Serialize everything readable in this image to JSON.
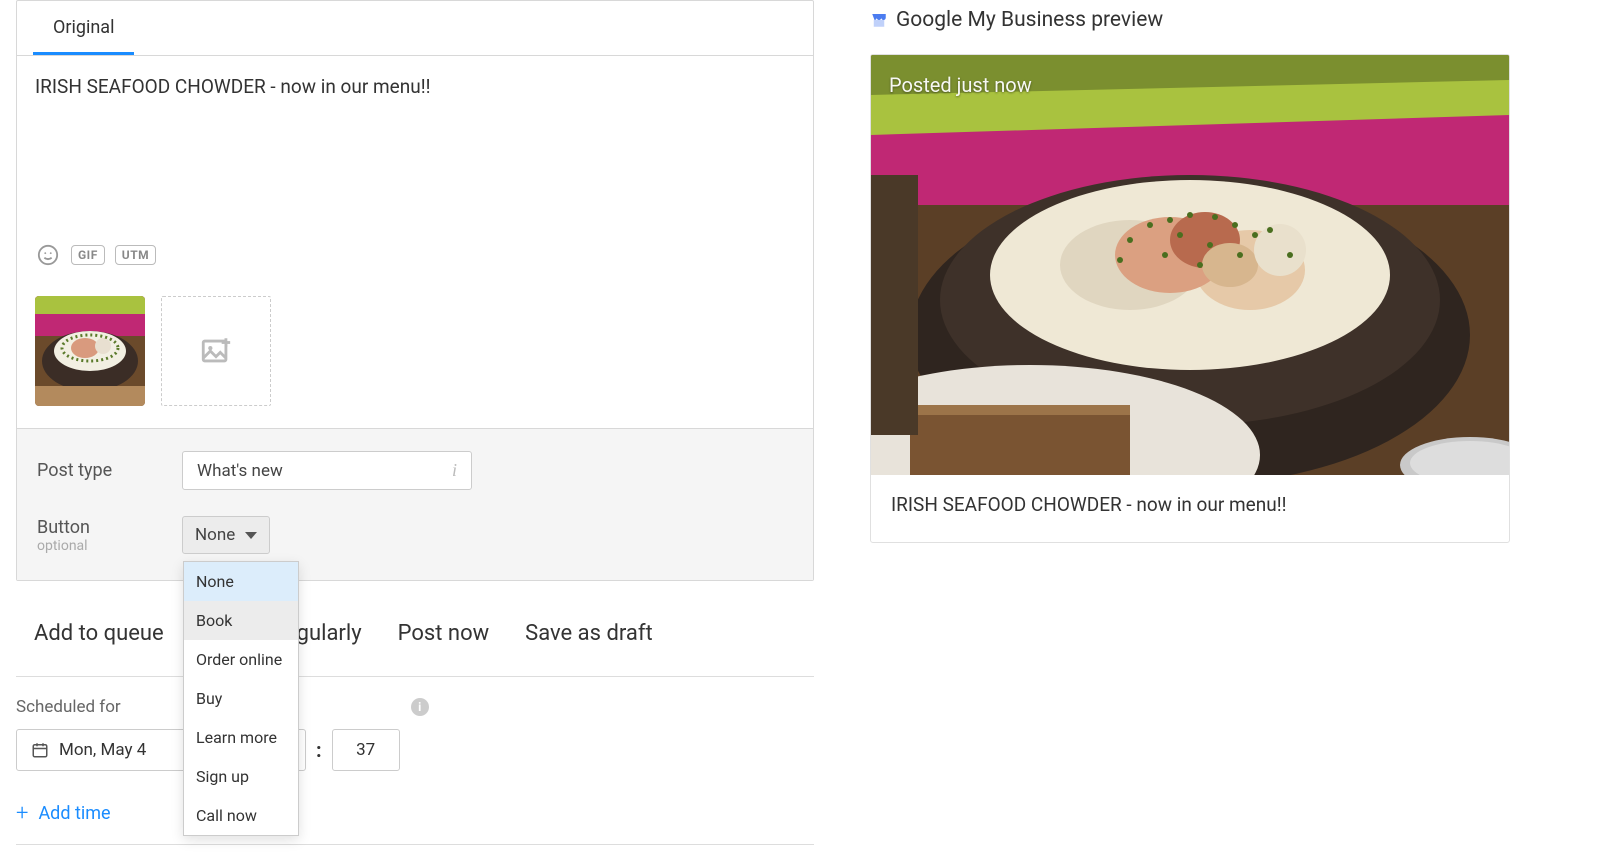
{
  "editor": {
    "tabs": [
      {
        "label": "Original",
        "active": true
      }
    ],
    "content": "IRISH SEAFOOD CHOWDER - now in our menu!!",
    "tools": {
      "gif_badge": "GIF",
      "utm_badge": "UTM"
    }
  },
  "form": {
    "post_type_label": "Post type",
    "post_type_value": "What's new",
    "button_label": "Button",
    "button_sublabel": "optional",
    "button_value": "None",
    "button_options": [
      "None",
      "Book",
      "Order online",
      "Buy",
      "Learn more",
      "Sign up",
      "Call now"
    ],
    "button_selected_index": 0,
    "button_hover_index": 1
  },
  "actions": [
    "Add to queue",
    "Publish regularly",
    "Post now",
    "Save as draft"
  ],
  "schedule": {
    "label": "Scheduled for",
    "date": "Mon, May 4",
    "minute": "37",
    "add_time_label": "Add time"
  },
  "preview": {
    "title": "Google My Business preview",
    "overlay": "Posted just now",
    "caption": "IRISH SEAFOOD CHOWDER - now in our menu!!"
  }
}
